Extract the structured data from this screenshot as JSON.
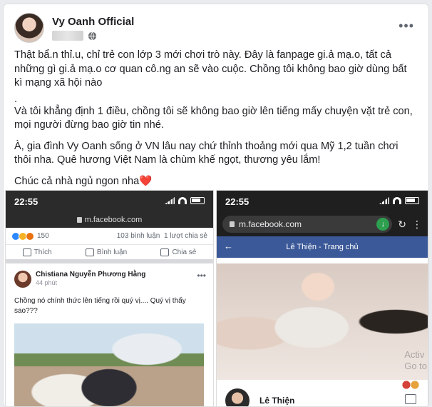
{
  "post": {
    "author": "Vy Oanh Official",
    "paragraphs": [
      "Thật bẩ.n thỉ.u, chỉ trẻ con lớp 3 mới chơi trò này. Đây là fanpage gi.ả mạ.o, tất cả những gì gi.ả mạ.o cơ quan cô.ng an sẽ vào cuộc. Chồng tôi không bao giờ dùng bất kì mạng xã hội nào",
      ".",
      "Và tôi khẳng định 1 điều, chồng tôi sẽ không bao giờ lên tiếng mấy chuyện vặt trẻ con, mọi người đừng bao giờ tin nhé.",
      "À, gia đình Vy Oanh sống ở VN lâu nay chứ thỉnh thoảng mới qua Mỹ 1,2 tuần chơi thôi nha. Quê hương Việt Nam là chùm khế ngọt, thương yêu lắm!",
      "Chúc cả nhà ngủ ngon nha"
    ],
    "heart": "❤️",
    "more_icon": "more-horizontal-icon",
    "privacy_icon": "globe-icon"
  },
  "screenshot1": {
    "time": "22:55",
    "url": "m.facebook.com",
    "reactions_count": "150",
    "comments": "103 bình luận",
    "shares": "1 lượt chia sẻ",
    "actions": [
      "Thích",
      "Bình luận",
      "Chia sẻ"
    ],
    "post_author": "Chistiana Nguyễn Phương Hằng",
    "post_time": "44 phút",
    "post_text": "Chồng nó chính thức lên tiếng rồi quý vị.... Quý vị thấy sao???"
  },
  "screenshot2": {
    "time": "22:55",
    "url": "m.facebook.com",
    "page_title": "Lê Thiện - Trang chủ",
    "profile_name": "Lê Thiện"
  },
  "watermark": [
    "Activ",
    "Go to"
  ],
  "colors": {
    "fb_blue": "#3b5998",
    "heart": "#e0245e",
    "download_green": "#2e9e4f"
  }
}
